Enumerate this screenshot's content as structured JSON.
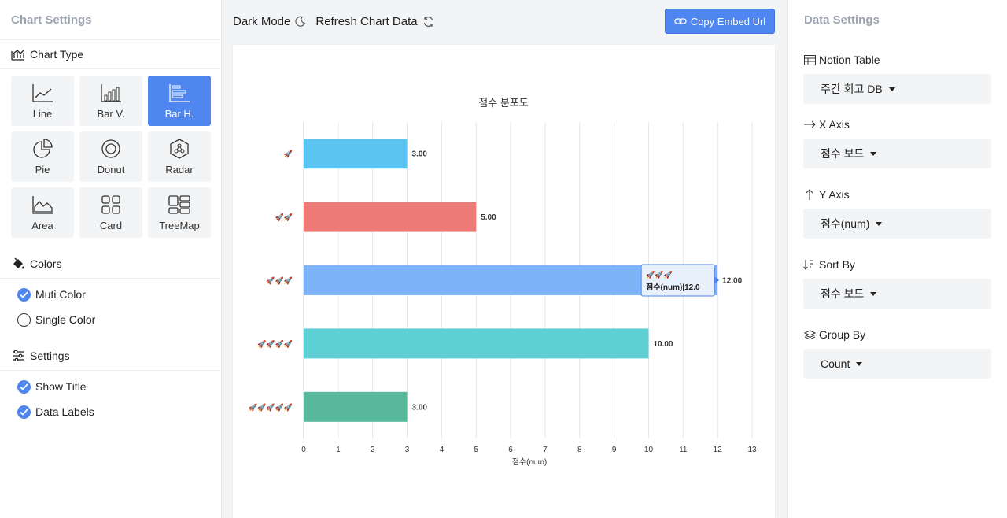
{
  "left_panel": {
    "title": "Chart Settings",
    "chart_type_label": "Chart Type",
    "chart_types": [
      {
        "label": "Line",
        "icon": "line-chart-icon",
        "active": false
      },
      {
        "label": "Bar V.",
        "icon": "bar-vertical-icon",
        "active": false
      },
      {
        "label": "Bar H.",
        "icon": "bar-horizontal-icon",
        "active": true
      },
      {
        "label": "Pie",
        "icon": "pie-chart-icon",
        "active": false
      },
      {
        "label": "Donut",
        "icon": "donut-chart-icon",
        "active": false
      },
      {
        "label": "Radar",
        "icon": "radar-chart-icon",
        "active": false
      },
      {
        "label": "Area",
        "icon": "area-chart-icon",
        "active": false
      },
      {
        "label": "Card",
        "icon": "card-icon",
        "active": false
      },
      {
        "label": "TreeMap",
        "icon": "treemap-icon",
        "active": false
      }
    ],
    "colors_label": "Colors",
    "color_options": [
      {
        "label": "Muti Color",
        "checked": true
      },
      {
        "label": "Single Color",
        "checked": false
      }
    ],
    "settings_label": "Settings",
    "settings_options": [
      {
        "label": "Show Title",
        "checked": true
      },
      {
        "label": "Data Labels",
        "checked": true
      }
    ]
  },
  "toolbar": {
    "dark_mode_label": "Dark Mode",
    "refresh_label": "Refresh Chart Data",
    "embed_label": "Copy Embed Url",
    "accent": "#4f86ef"
  },
  "right_panel": {
    "title": "Data Settings",
    "fields": [
      {
        "label": "Notion Table",
        "icon": "table-icon",
        "value": "주간 회고 DB"
      },
      {
        "label": "X Axis",
        "icon": "arrow-right-icon",
        "value": "점수 보드"
      },
      {
        "label": "Y Axis",
        "icon": "arrow-up-icon",
        "value": "점수(num)"
      },
      {
        "label": "Sort By",
        "icon": "sort-icon",
        "value": "점수 보드"
      },
      {
        "label": "Group By",
        "icon": "layers-icon",
        "value": "Count"
      }
    ]
  },
  "chart_data": {
    "type": "bar",
    "orientation": "horizontal",
    "title": "점수 분포도",
    "xlabel": "점수(num)",
    "ylabel": "",
    "categories": [
      "🚀",
      "🚀🚀",
      "🚀🚀🚀",
      "🚀🚀🚀🚀",
      "🚀🚀🚀🚀🚀"
    ],
    "values": [
      3,
      5,
      12,
      10,
      3
    ],
    "value_labels": [
      "3.00",
      "5.00",
      "12.00",
      "10.00",
      "3.00"
    ],
    "colors": [
      "#5bc4f1",
      "#ec7b78",
      "#7db3f7",
      "#5ecfd2",
      "#58b89c"
    ],
    "xlim": [
      0,
      13
    ],
    "xticks": [
      "0",
      "1",
      "2",
      "3",
      "4",
      "5",
      "6",
      "7",
      "8",
      "9",
      "10",
      "11",
      "12",
      "13"
    ],
    "grid": true,
    "tooltip": {
      "category": "🚀🚀🚀",
      "text": "점수(num)|12.0"
    }
  }
}
